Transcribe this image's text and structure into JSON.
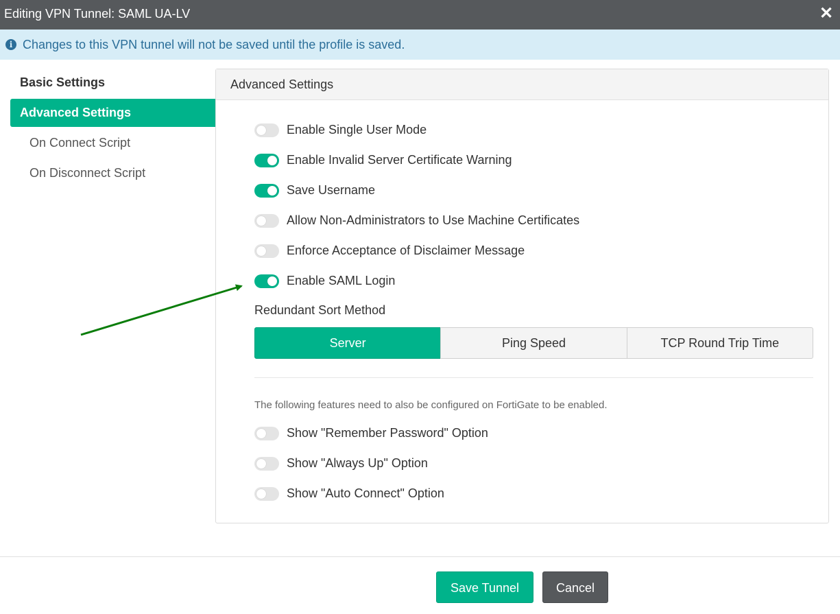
{
  "window": {
    "title": "Editing VPN Tunnel: SAML UA-LV",
    "close_glyph": "✕"
  },
  "info": {
    "icon_glyph": "i",
    "message": "Changes to this VPN tunnel will not be saved until the profile is saved."
  },
  "nav": {
    "basic": "Basic Settings",
    "advanced": "Advanced Settings",
    "on_connect": "On Connect Script",
    "on_disconnect": "On Disconnect Script"
  },
  "panel": {
    "title": "Advanced Settings",
    "toggles": [
      {
        "label": "Enable Single User Mode",
        "on": false
      },
      {
        "label": "Enable Invalid Server Certificate Warning",
        "on": true
      },
      {
        "label": "Save Username",
        "on": true
      },
      {
        "label": "Allow Non-Administrators to Use Machine Certificates",
        "on": false
      },
      {
        "label": "Enforce Acceptance of Disclaimer Message",
        "on": false
      },
      {
        "label": "Enable SAML Login",
        "on": true
      }
    ],
    "sort_label": "Redundant Sort Method",
    "sort_options": [
      "Server",
      "Ping Speed",
      "TCP Round Trip Time"
    ],
    "sort_selected": "Server",
    "note": "The following features need to also be configured on FortiGate to be enabled.",
    "fortigate_toggles": [
      {
        "label": "Show \"Remember Password\" Option",
        "on": false
      },
      {
        "label": "Show \"Always Up\" Option",
        "on": false
      },
      {
        "label": "Show \"Auto Connect\" Option",
        "on": false
      }
    ]
  },
  "footer": {
    "save": "Save Tunnel",
    "cancel": "Cancel"
  },
  "colors": {
    "accent": "#00b38b",
    "annotation_arrow": "#0a7d0a",
    "titlebar": "#56595c",
    "info_bg": "#d7edf7"
  }
}
